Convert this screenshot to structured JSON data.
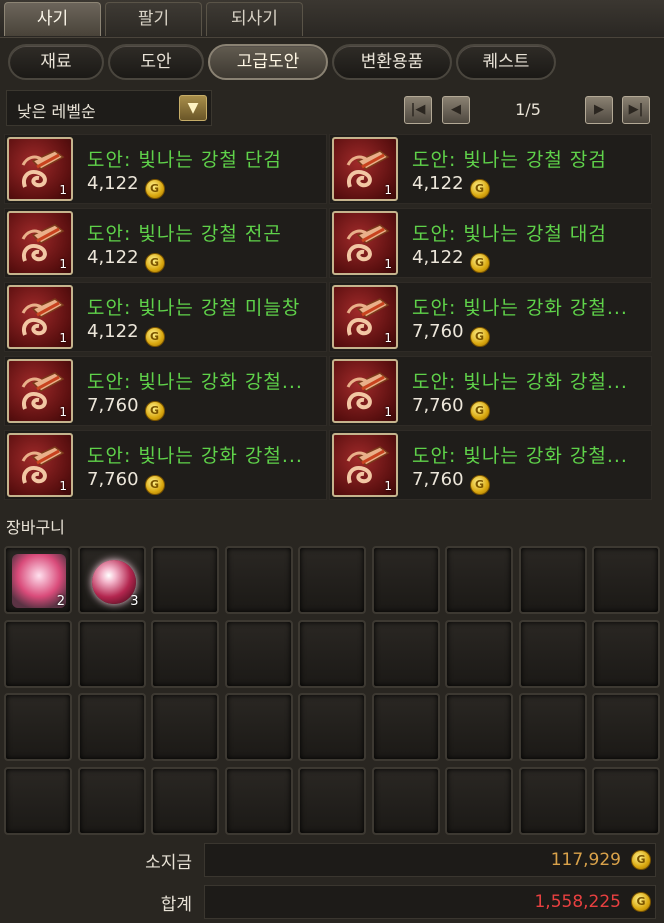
{
  "main_tabs": [
    "사기",
    "팔기",
    "되사기"
  ],
  "sub_tabs": [
    "재료",
    "도안",
    "고급도안",
    "변환용품",
    "퀘스트"
  ],
  "sort": {
    "label": "낮은 레벨순"
  },
  "pagination": {
    "current": "1/5"
  },
  "items": [
    {
      "name": "도안: 빛나는 강철 단검",
      "price": "4,122",
      "qty": "1"
    },
    {
      "name": "도안: 빛나는 강철 장검",
      "price": "4,122",
      "qty": "1"
    },
    {
      "name": "도안: 빛나는 강철 전곤",
      "price": "4,122",
      "qty": "1"
    },
    {
      "name": "도안: 빛나는 강철 대검",
      "price": "4,122",
      "qty": "1"
    },
    {
      "name": "도안: 빛나는 강철 미늘창",
      "price": "4,122",
      "qty": "1"
    },
    {
      "name": "도안: 빛나는 강화 강철...",
      "price": "7,760",
      "qty": "1"
    },
    {
      "name": "도안: 빛나는 강화 강철...",
      "price": "7,760",
      "qty": "1"
    },
    {
      "name": "도안: 빛나는 강화 강철...",
      "price": "7,760",
      "qty": "1"
    },
    {
      "name": "도안: 빛나는 강화 강철...",
      "price": "7,760",
      "qty": "1"
    },
    {
      "name": "도안: 빛나는 강화 강철...",
      "price": "7,760",
      "qty": "1"
    }
  ],
  "cart": {
    "title": "장바구니",
    "slots": [
      {
        "qty": "2"
      },
      {
        "qty": "3"
      }
    ]
  },
  "summary": {
    "owned_label": "소지금",
    "owned_value": "117,929",
    "total_label": "합계",
    "total_value": "1,558,225"
  },
  "colors": {
    "item_name": "#5fd24a",
    "owned_value": "#d9a24a",
    "total_value": "#e84040"
  }
}
